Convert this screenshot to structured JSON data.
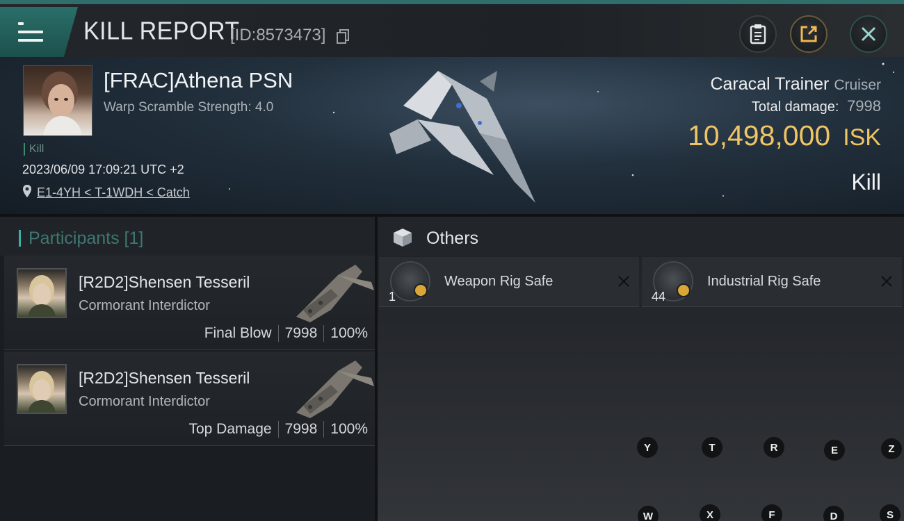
{
  "header": {
    "title": "KILL REPORT",
    "report_id": "[ID:8573473]",
    "icons": [
      "menu-icon",
      "copy-icon",
      "clipboard-icon",
      "share-icon",
      "close-icon"
    ]
  },
  "victim": {
    "name": "[FRAC]Athena PSN",
    "scramble": "Warp Scramble Strength: 4.0",
    "tag": "Kill",
    "timestamp": "2023/06/09 17:09:21 UTC +2",
    "location": "E1-4YH < T-1WDH < Catch",
    "ship_name": "Caracal Trainer",
    "ship_class": "Cruiser",
    "total_damage_label": "Total damage:",
    "total_damage": "7998",
    "isk_value": "10,498,000",
    "isk_unit": "ISK",
    "outcome": "Kill"
  },
  "participants": {
    "header": "Participants [1]",
    "rows": [
      {
        "name": "[R2D2]Shensen Tesseril",
        "ship": "Cormorant Interdictor",
        "role": "Final Blow",
        "damage": "7998",
        "percent": "100%"
      },
      {
        "name": "[R2D2]Shensen Tesseril",
        "ship": "Cormorant Interdictor",
        "role": "Top Damage",
        "damage": "7998",
        "percent": "100%"
      }
    ]
  },
  "others": {
    "header": "Others",
    "items": [
      {
        "name": "Weapon Rig Safe",
        "quantity": "1"
      },
      {
        "name": "Industrial Rig Safe",
        "quantity": "44"
      }
    ]
  },
  "hotkeys": [
    "Y",
    "T",
    "R",
    "E",
    "Z",
    "W",
    "X",
    "F",
    "D",
    "S"
  ],
  "colors": {
    "accent_teal": "#2f6e6a",
    "isk_gold": "#f0c463",
    "participants_header": "#3f7771"
  }
}
